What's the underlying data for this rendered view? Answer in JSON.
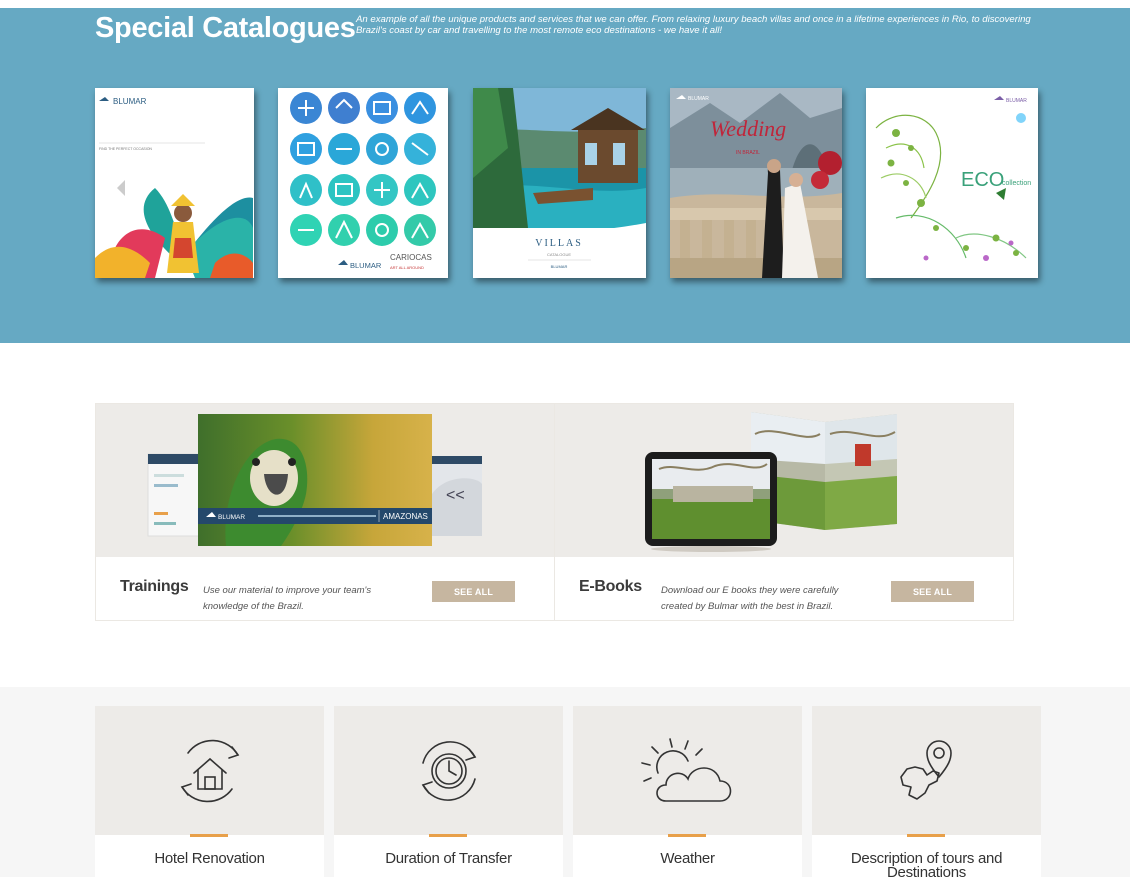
{
  "catalogues": {
    "title": "Special Catalogues",
    "description": "An example of all the unique products and services that we can offer. From relaxing luxury beach villas and once in a lifetime experiences in Rio, to discovering Brazil's coast by car and travelling to the most remote eco destinations - we have it all!",
    "covers": [
      {
        "name": "Carnival catalogue",
        "brand": "BLUMAR",
        "subtitle": "FIND THE PERFECT OCCASION"
      },
      {
        "name": "Cariocas catalogue",
        "brand": "BLUMAR",
        "label": "CARIOCAS",
        "sublabel": "ART ALL AROUND"
      },
      {
        "name": "Villas catalogue",
        "label": "VILLAS",
        "sublabel": "CATALOGUE",
        "brand": "BLUMAR"
      },
      {
        "name": "Wedding catalogue",
        "brand": "BLUMAR",
        "label": "Wedding",
        "sublabel": "IN BRAZIL"
      },
      {
        "name": "Eco collection catalogue",
        "brand": "BLUMAR",
        "label": "ECO",
        "sublabel": "collection"
      }
    ]
  },
  "trainings": {
    "title": "Trainings",
    "text": "Use our material to improve your team's knowledge of the Brazil.",
    "button": "SEE ALL",
    "image_caption": "AMAZONAS",
    "image_brand": "BLUMAR"
  },
  "ebooks": {
    "title": "E-Books",
    "text": "Download our E books they were carefully created by Bulmar with the best in Brazil.",
    "button": "SEE ALL"
  },
  "tiles": [
    {
      "label": "Hotel Renovation",
      "icon": "house-refresh-icon"
    },
    {
      "label": "Duration of Transfer",
      "icon": "clock-refresh-icon"
    },
    {
      "label": "Weather",
      "icon": "sun-cloud-icon"
    },
    {
      "label": "Description of tours and Destinations",
      "icon": "map-pin-icon"
    }
  ],
  "colors": {
    "band": "#66a9c3",
    "button": "#c6b6a0",
    "accent": "#e8a04a"
  }
}
